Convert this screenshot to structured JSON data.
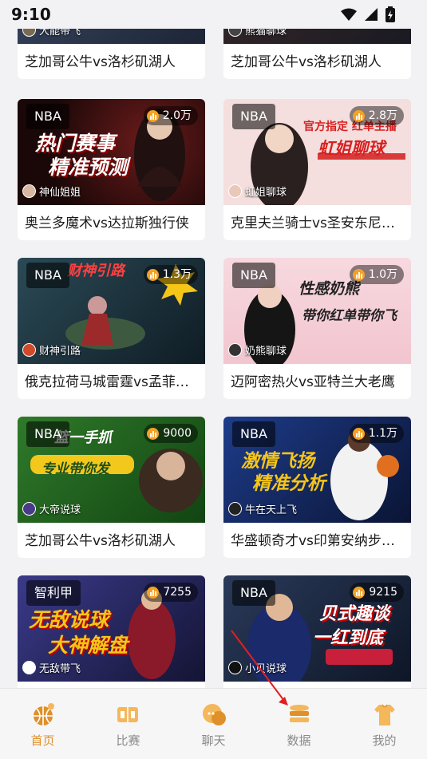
{
  "status": {
    "time": "9:10"
  },
  "top_row": [
    {
      "title": "芝加哥公牛vs洛杉矶湖人",
      "host": "大能带飞"
    },
    {
      "title": "芝加哥公牛vs洛杉矶湖人",
      "host": "熊猫聊球"
    }
  ],
  "cards": [
    {
      "league": "NBA",
      "views": "2.0万",
      "host": "神仙姐姐",
      "title": "奥兰多魔术vs达拉斯独行侠",
      "banner": "热门赛事",
      "banner2": "精准预测"
    },
    {
      "league": "NBA",
      "views": "2.8万",
      "host": "虹姐聊球",
      "title": "克里夫兰骑士vs圣安东尼…",
      "banner": "官方指定 红单主播",
      "banner2": "虹姐聊球"
    },
    {
      "league": "NBA",
      "views": "1.3万",
      "host": "财神引路",
      "title": "俄克拉荷马城雷霆vs孟菲…",
      "banner": "财神引路",
      "banner2": ""
    },
    {
      "league": "NBA",
      "views": "1.0万",
      "host": "奶熊聊球",
      "title": "迈阿密热火vs亚特兰大老鹰",
      "banner": "性感奶熊",
      "banner2": "带你红单带你飞"
    },
    {
      "league": "NBA",
      "views": "9000",
      "host": "大帝说球",
      "title": "芝加哥公牛vs洛杉矶湖人",
      "banner": "篮一手抓",
      "banner2": "专业带你发"
    },
    {
      "league": "NBA",
      "views": "1.1万",
      "host": "牛在天上飞",
      "title": "华盛顿奇才vs印第安纳步…",
      "banner": "激情飞扬",
      "banner2": "精准分析"
    },
    {
      "league": "智利甲",
      "views": "7255",
      "host": "无敌带飞",
      "title": "",
      "banner": "无敌说球",
      "banner2": "大神解盘"
    },
    {
      "league": "NBA",
      "views": "9215",
      "host": "小贝说球",
      "title": "",
      "banner": "贝式趣谈",
      "banner2": "一红到底"
    }
  ],
  "tabs": [
    {
      "label": "首页"
    },
    {
      "label": "比赛"
    },
    {
      "label": "聊天"
    },
    {
      "label": "数据"
    },
    {
      "label": "我的"
    }
  ],
  "colors": {
    "accent": "#e0902a",
    "inactive": "#8a8a8a",
    "annotation_arrow": "#e02020"
  }
}
